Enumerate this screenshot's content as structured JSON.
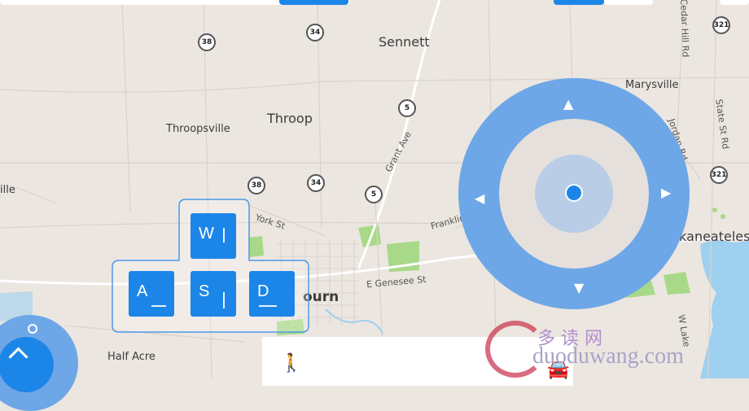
{
  "places": {
    "sennett": "Sennett",
    "throop": "Throop",
    "throopsville": "Throopsville",
    "marysville": "Marysville",
    "skaneateles": "Skaneateles",
    "ville": "ille",
    "auburn": "ourn",
    "half_acre": "Half Acre"
  },
  "roads": {
    "grant_ave": "Grant Ave",
    "york_st": "York St",
    "franklin_st": "Franklin St Rd",
    "e_genesee": "E Genesee St",
    "jordan_rd": "Jordan Rd",
    "state_st": "State St Rd",
    "cedar_hill": "Cedar Hill Rd",
    "w_lake": "W Lake"
  },
  "shields": [
    "38",
    "34",
    "5",
    "321",
    "38",
    "34",
    "5",
    "321"
  ],
  "keys": {
    "w": "W",
    "a": "A",
    "s": "S",
    "d": "D"
  },
  "joystick": {
    "up": "▲",
    "down": "▼",
    "left": "◀",
    "right": "▶"
  },
  "bottom_panel": {
    "walk_icon": "walk-icon",
    "car_icon": "car-icon"
  },
  "watermark": {
    "line1": "多  读  网",
    "line2": "duoduwang.com"
  },
  "colors": {
    "accent": "#1c86e8",
    "joystick_ring": "#6ea7e7",
    "map_bg": "#ece6e0",
    "park": "#9fd67a",
    "water": "#9ed0f0"
  }
}
